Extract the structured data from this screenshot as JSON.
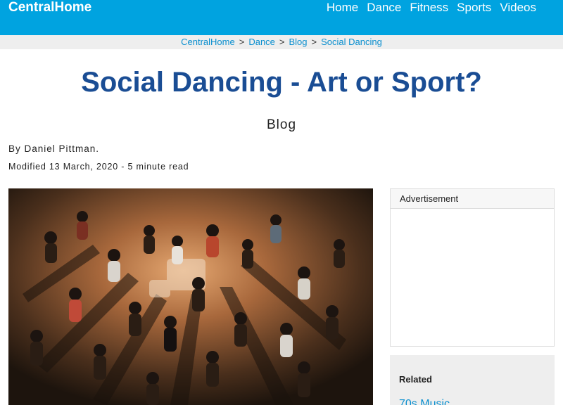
{
  "header": {
    "brand": "CentralHome",
    "nav": [
      "Home",
      "Dance",
      "Fitness",
      "Sports",
      "Videos"
    ]
  },
  "breadcrumb": {
    "items": [
      "CentralHome",
      "Dance",
      "Blog",
      "Social Dancing"
    ],
    "separator": ">"
  },
  "article": {
    "title": "Social Dancing - Art or Sport?",
    "category": "Blog",
    "byline": "By Daniel Pittman.",
    "meta": "Modified 13 March, 2020 - 5 minute read"
  },
  "sidebar": {
    "ad_label": "Advertisement",
    "related_heading": "Related",
    "related_links": [
      "70s Music"
    ]
  },
  "colors": {
    "header_bg": "#00a3e0",
    "title": "#1a4d94",
    "link": "#0a8fcf"
  }
}
